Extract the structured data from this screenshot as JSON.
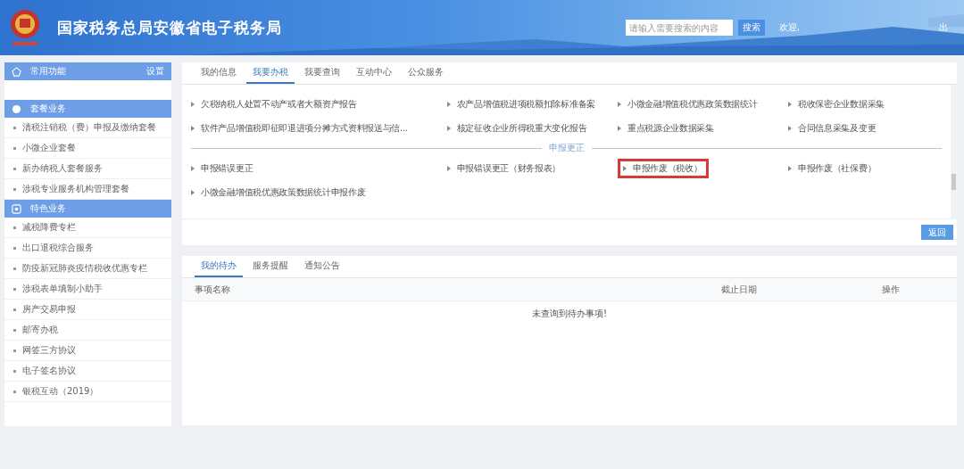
{
  "header": {
    "title": "国家税务总局安徽省电子税务局",
    "search": {
      "placeholder": "请输入需要搜索的内容"
    },
    "search_button": "搜索",
    "welcome": "欢迎,",
    "logout": "出"
  },
  "sidebar": {
    "sections": [
      {
        "title": "常用功能",
        "action": "设置"
      },
      {
        "title": "套餐业务",
        "items": [
          "清税注销税（费）申报及缴纳套餐",
          "小微企业套餐",
          "新办纳税人套餐服务",
          "涉税专业服务机构管理套餐"
        ]
      },
      {
        "title": "特色业务",
        "items": [
          "减税降费专栏",
          "出口退税综合服务",
          "防疫新冠肺炎疫情税收优惠专栏",
          "涉税表单填制小助手",
          "房产交易申报",
          "邮寄办税",
          "网签三方协议",
          "电子签名协议",
          "银税互动（2019）"
        ]
      }
    ]
  },
  "main": {
    "tabs": [
      {
        "label": "我的信息",
        "selected": false
      },
      {
        "label": "我要办税",
        "selected": true
      },
      {
        "label": "我要查询",
        "selected": false
      },
      {
        "label": "互动中心",
        "selected": false
      },
      {
        "label": "公众服务",
        "selected": false
      }
    ],
    "groups": [
      {
        "items": [
          {
            "label": "欠税纳税人处置不动产或者大额资产报告",
            "highlighted": false
          },
          {
            "label": "农产品增值税进项税额扣除标准备案",
            "highlighted": false
          },
          {
            "label": "小微金融增值税优惠政策数据统计",
            "highlighted": false
          },
          {
            "label": "税收保密企业数据采集",
            "highlighted": false
          },
          {
            "label": "软件产品增值税即征即退进项分摊方式资料报送与信...",
            "highlighted": false
          },
          {
            "label": "核定征收企业所得税重大变化报告",
            "highlighted": false
          },
          {
            "label": "重点税源企业数据采集",
            "highlighted": false
          },
          {
            "label": "合同信息采集及变更",
            "highlighted": false
          }
        ]
      },
      {
        "heading": "申报更正",
        "items": [
          {
            "label": "申报错误更正",
            "highlighted": false
          },
          {
            "label": "申报错误更正（财务报表）",
            "highlighted": false
          },
          {
            "label": "申报作废（税收）",
            "highlighted": true
          },
          {
            "label": "申报作废（社保费）",
            "highlighted": false
          },
          {
            "label": "小微金融增值税优惠政策数据统计申报作废",
            "highlighted": false
          }
        ]
      }
    ],
    "back_button": "返回"
  },
  "todo": {
    "tabs": [
      {
        "label": "我的待办",
        "selected": true
      },
      {
        "label": "服务提醒",
        "selected": false
      },
      {
        "label": "通知公告",
        "selected": false
      }
    ],
    "columns": [
      "事项名称",
      "截止日期",
      "操作"
    ],
    "empty_message": "未查询到待办事项!"
  }
}
